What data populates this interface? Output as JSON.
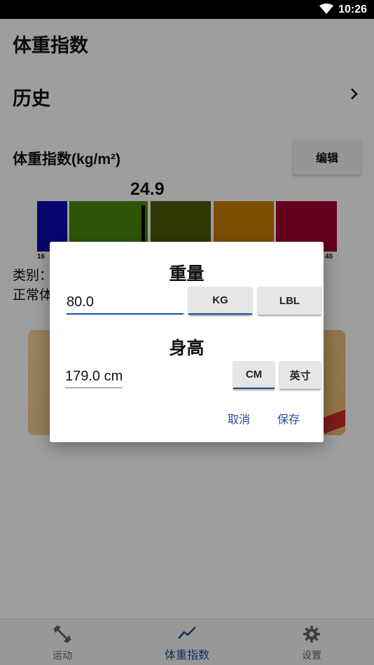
{
  "status_bar": {
    "time": "10:26",
    "wifi_icon": "wifi-icon"
  },
  "app_title": "体重指数",
  "history": {
    "label": "历史",
    "icon": "chevron-right-icon"
  },
  "bmi": {
    "header": "体重指数(kg/m²)",
    "edit_label": "编辑",
    "value": "24.9",
    "scale": {
      "segments": [
        {
          "color": "#0b0bb0"
        },
        {
          "color": "#4a8a0e"
        },
        {
          "color": "#4b5b08"
        },
        {
          "color": "#c97f00"
        },
        {
          "color": "#a3002e"
        }
      ],
      "ticks": [
        "16",
        "40"
      ]
    },
    "category_label": "类别：",
    "status_text": "正常体"
  },
  "bottom_nav": {
    "items": [
      {
        "label": "运动",
        "icon": "dumbbell-icon"
      },
      {
        "label": "体重指数",
        "icon": "trend-line-icon",
        "active": true
      },
      {
        "label": "设置",
        "icon": "gear-icon"
      }
    ]
  },
  "dialog": {
    "weight_title": "重量",
    "weight_value": "80.0",
    "weight_units": [
      "KG",
      "LBL"
    ],
    "height_title": "身高",
    "height_value": "179.0 cm",
    "height_units": [
      "CM",
      "英寸"
    ],
    "cancel_label": "取消",
    "save_label": "保存",
    "accent_color": "#1b4f9a"
  }
}
